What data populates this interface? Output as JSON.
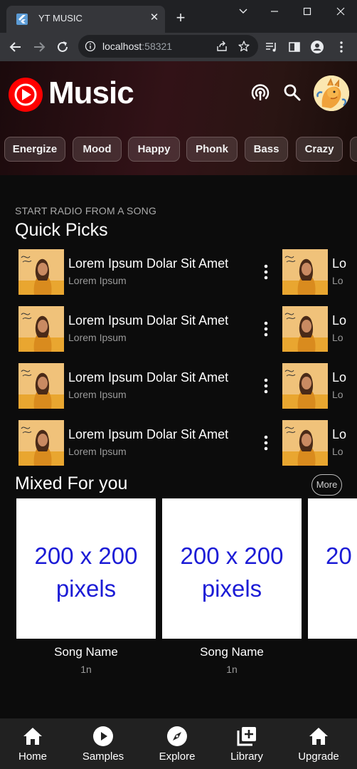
{
  "browser": {
    "tab_title": "YT MUSIC",
    "url_host": "localhost",
    "url_port": ":58321"
  },
  "header": {
    "brand": "Music",
    "chips": [
      "Energize",
      "Mood",
      "Happy",
      "Phonk",
      "Bass",
      "Crazy"
    ]
  },
  "quick_picks": {
    "kicker": "START RADIO FROM A SONG",
    "title": "Quick Picks",
    "items": [
      {
        "title": "Lorem Ipsum Dolar Sit Amet",
        "artist": "Lorem Ipsum"
      },
      {
        "title": "Lorem Ipsum Dolar Sit Amet",
        "artist": "Lorem Ipsum"
      },
      {
        "title": "Lorem Ipsum Dolar Sit Amet",
        "artist": "Lorem Ipsum"
      },
      {
        "title": "Lorem Ipsum Dolar Sit Amet",
        "artist": "Lorem Ipsum"
      }
    ],
    "next_column_titles": [
      "Lo",
      "Lo",
      "Lo",
      "Lo"
    ],
    "next_column_subs": [
      "Lo",
      "Lo",
      "Lo",
      "Lo"
    ]
  },
  "mixed": {
    "title": "Mixed For you",
    "more_label": "More",
    "cards": [
      {
        "placeholder_l1": "200 x 200",
        "placeholder_l2": "pixels",
        "name": "Song Name",
        "sub": "1n"
      },
      {
        "placeholder_l1": "200 x 200",
        "placeholder_l2": "pixels",
        "name": "Song Name",
        "sub": "1n"
      },
      {
        "placeholder_l1": "20",
        "placeholder_l2": "",
        "name": "",
        "sub": ""
      }
    ]
  },
  "bottom_nav": [
    {
      "label": "Home",
      "icon": "home-icon"
    },
    {
      "label": "Samples",
      "icon": "play-circle-icon"
    },
    {
      "label": "Explore",
      "icon": "compass-icon"
    },
    {
      "label": "Library",
      "icon": "library-add-icon"
    },
    {
      "label": "Upgrade",
      "icon": "upgrade-home-icon"
    }
  ],
  "colors": {
    "accent_red": "#ff0000",
    "placeholder_text": "#1c1cd6",
    "nav_bg": "#212121"
  }
}
